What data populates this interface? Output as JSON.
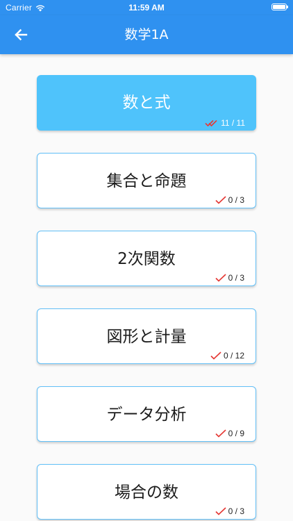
{
  "status_bar": {
    "carrier": "Carrier",
    "time": "11:59 AM"
  },
  "appbar": {
    "title": "数学1A",
    "back_icon": "arrow-left-icon",
    "color": "#2f91f0"
  },
  "topics": [
    {
      "label": "数と式",
      "progress": "11 / 11",
      "selected": true,
      "check_icon": "double-check-icon"
    },
    {
      "label": "集合と命題",
      "progress": "0 / 3",
      "selected": false,
      "check_icon": "check-icon"
    },
    {
      "label": "2次関数",
      "progress": "0 / 3",
      "selected": false,
      "check_icon": "check-icon"
    },
    {
      "label": "図形と計量",
      "progress": "0 / 12",
      "selected": false,
      "check_icon": "check-icon"
    },
    {
      "label": "データ分析",
      "progress": "0 / 9",
      "selected": false,
      "check_icon": "check-icon"
    },
    {
      "label": "場合の数",
      "progress": "0 / 3",
      "selected": false,
      "check_icon": "check-icon"
    }
  ],
  "colors": {
    "selected_card": "#4fc3fb",
    "card_border": "#61bff7",
    "check": "#e53935"
  }
}
